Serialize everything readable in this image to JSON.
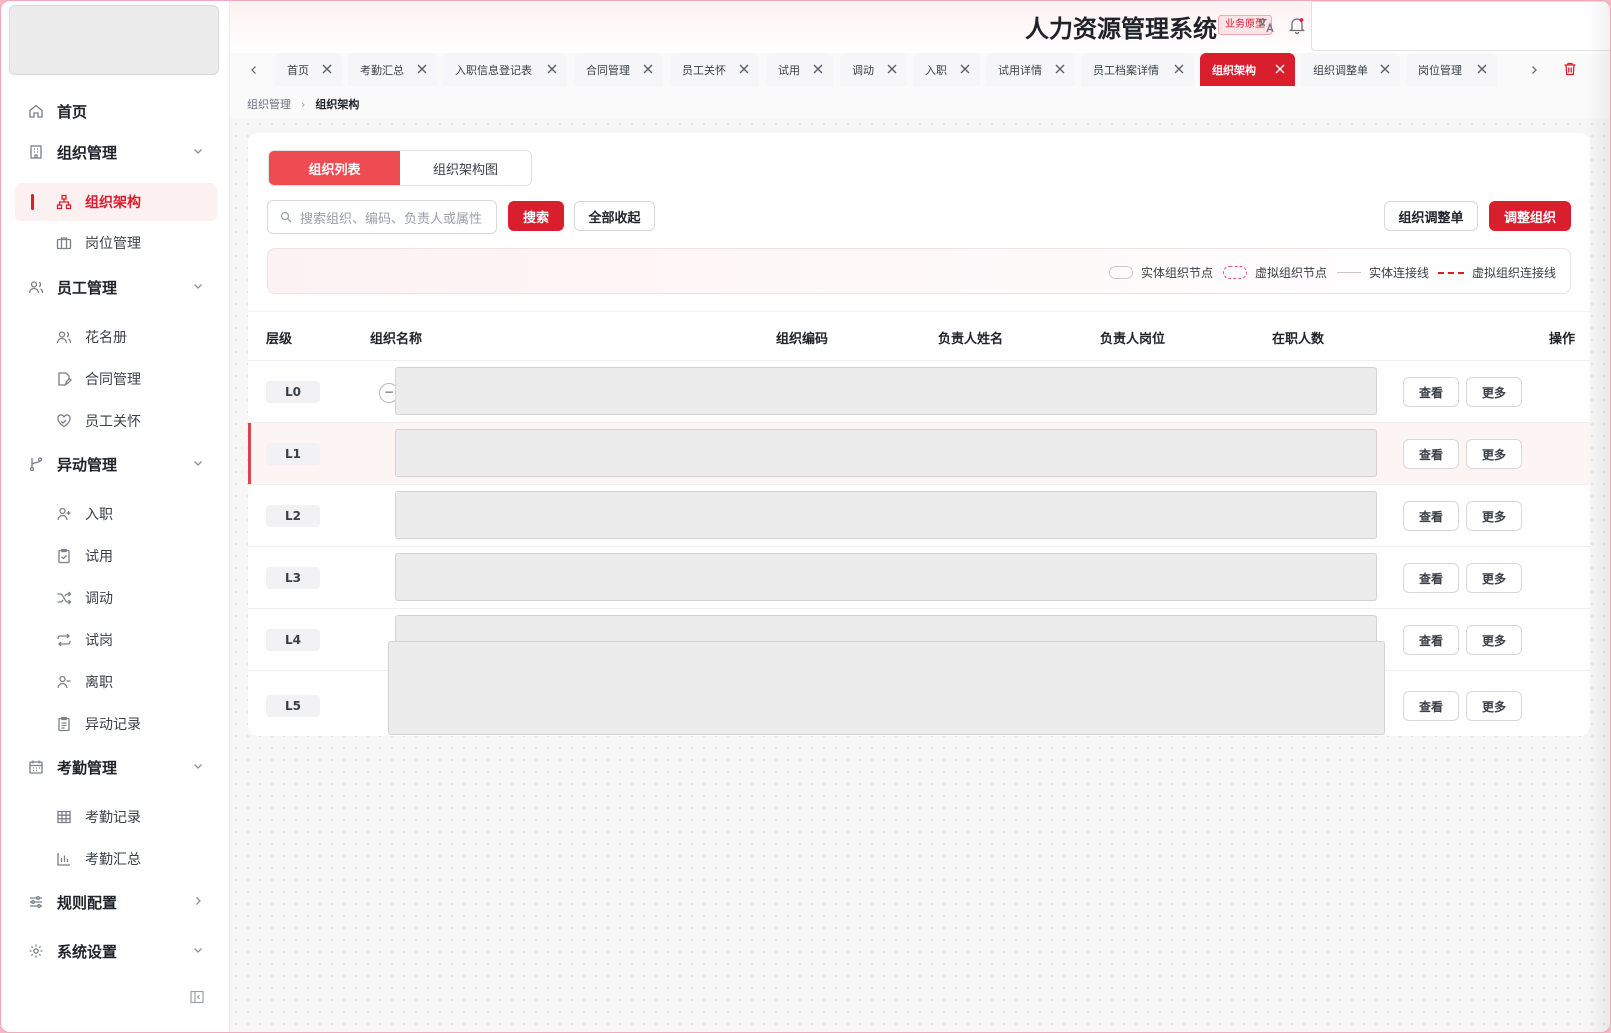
{
  "header": {
    "title": "人力资源管理系统",
    "badge": "业务原型"
  },
  "sidebar": {
    "items": [
      {
        "label": "首页",
        "icon": "home-icon"
      },
      {
        "label": "组织管理",
        "icon": "building-icon"
      },
      {
        "label": "组织架构",
        "icon": "org-chart-icon"
      },
      {
        "label": "岗位管理",
        "icon": "briefcase-icon"
      },
      {
        "label": "员工管理",
        "icon": "users-icon"
      },
      {
        "label": "花名册",
        "icon": "users-icon"
      },
      {
        "label": "合同管理",
        "icon": "contract-icon"
      },
      {
        "label": "员工关怀",
        "icon": "heart-hand-icon"
      },
      {
        "label": "异动管理",
        "icon": "branch-icon"
      },
      {
        "label": "入职",
        "icon": "user-plus-icon"
      },
      {
        "label": "试用",
        "icon": "clipboard-check-icon"
      },
      {
        "label": "调动",
        "icon": "shuffle-icon"
      },
      {
        "label": "试岗",
        "icon": "repeat-icon"
      },
      {
        "label": "离职",
        "icon": "user-minus-icon"
      },
      {
        "label": "异动记录",
        "icon": "clipboard-list-icon"
      },
      {
        "label": "考勤管理",
        "icon": "calendar-icon"
      },
      {
        "label": "考勤记录",
        "icon": "table-icon"
      },
      {
        "label": "考勤汇总",
        "icon": "bar-chart-icon"
      },
      {
        "label": "规则配置",
        "icon": "sliders-icon"
      },
      {
        "label": "系统设置",
        "icon": "gear-icon"
      }
    ]
  },
  "tabs": [
    {
      "label": "首页"
    },
    {
      "label": "考勤汇总"
    },
    {
      "label": "入职信息登记表"
    },
    {
      "label": "合同管理"
    },
    {
      "label": "员工关怀"
    },
    {
      "label": "试用"
    },
    {
      "label": "调动"
    },
    {
      "label": "入职"
    },
    {
      "label": "试用详情"
    },
    {
      "label": "员工档案详情"
    },
    {
      "label": "组织架构"
    },
    {
      "label": "组织调整单"
    },
    {
      "label": "岗位管理"
    }
  ],
  "breadcrumb": {
    "parent": "组织管理",
    "current": "组织架构"
  },
  "view_switch": {
    "list": "组织列表",
    "chart": "组织架构图"
  },
  "toolbar": {
    "search_placeholder": "搜索组织、编码、负责人或属性",
    "search_button": "搜索",
    "collapse_all": "全部收起",
    "adjust_order": "组织调整单",
    "adjust_org": "调整组织"
  },
  "legend": {
    "solid_node": "实体组织节点",
    "virtual_node": "虚拟组织节点",
    "solid_line": "实体连接线",
    "virtual_line": "虚拟组织连接线"
  },
  "table": {
    "columns": [
      "层级",
      "组织名称",
      "组织编码",
      "负责人姓名",
      "负责人岗位",
      "在职人数",
      "操作"
    ],
    "rows": [
      {
        "level": "L0",
        "view": "查看",
        "more": "更多"
      },
      {
        "level": "L1",
        "view": "查看",
        "more": "更多"
      },
      {
        "level": "L2",
        "view": "查看",
        "more": "更多"
      },
      {
        "level": "L3",
        "view": "查看",
        "more": "更多"
      },
      {
        "level": "L4",
        "view": "查看",
        "more": "更多"
      },
      {
        "level": "L5",
        "view": "查看",
        "more": "更多"
      }
    ]
  },
  "colors": {
    "accent": "#d91e2e",
    "accent_soft": "#ee4b52"
  }
}
